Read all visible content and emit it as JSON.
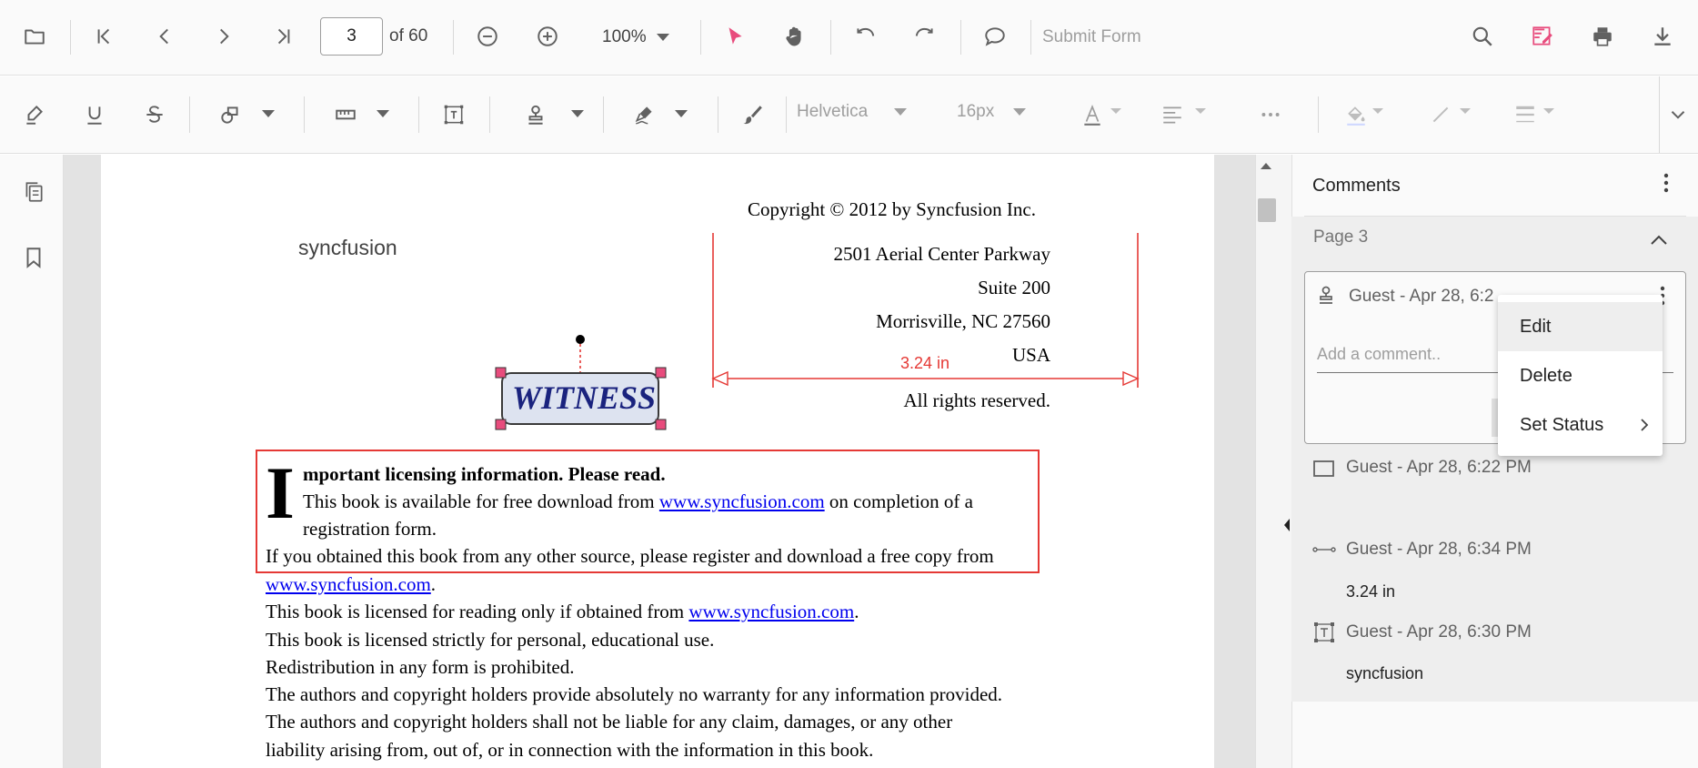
{
  "toolbar": {
    "page_current": "3",
    "page_of": "of 60",
    "zoom": "100%",
    "submit_form": "Submit Form"
  },
  "annotation_toolbar": {
    "font_family": "Helvetica",
    "font_size": "16px"
  },
  "document": {
    "copyright": "Copyright © 2012 by Syncfusion Inc.",
    "free_text": "syncfusion",
    "address_1": "2501 Aerial Center Parkway",
    "address_2": "Suite 200",
    "address_3": "Morrisville, NC 27560",
    "address_4": "USA",
    "measurement": "3.24 in",
    "rights": "All rights reserved.",
    "stamp": "WITNESS",
    "dropcap": "I",
    "heading": "mportant licensing information. Please read.",
    "p1_a": "This book is available for free download from ",
    "p1_link": "www.syncfusion.com",
    "p1_b": " on completion of a",
    "p1_c": "registration form.",
    "p2_a": "If you obtained this book from any other source, please register and download a free copy from",
    "p2_link": "www.syncfusion.com",
    "p2_b": ".",
    "p3_a": "This book is licensed for reading only if obtained from ",
    "p3_link": "www.syncfusion.com",
    "p3_b": ".",
    "p4": "This book is licensed strictly for personal, educational use.",
    "p5": "Redistribution in any form is prohibited.",
    "p6": "The authors and copyright holders provide absolutely no warranty for any information provided.",
    "p7": "The authors and copyright holders shall not be liable for any claim, damages, or any other",
    "p8": "liability arising from, out of, or in connection with the information in this book."
  },
  "comments": {
    "title": "Comments",
    "page_label": "Page 3",
    "card_author": "Guest - Apr 28, 6:2",
    "add_placeholder": "Add a comment..",
    "items": [
      {
        "author": "Guest - Apr 28, 6:22 PM",
        "icon": "rectangle-icon",
        "text": ""
      },
      {
        "author": "Guest - Apr 28, 6:34 PM",
        "icon": "distance-icon",
        "text": "3.24 in"
      },
      {
        "author": "Guest - Apr 28, 6:30 PM",
        "icon": "free-text-icon",
        "text": "syncfusion"
      }
    ]
  },
  "context_menu": {
    "edit": "Edit",
    "delete": "Delete",
    "set_status": "Set Status"
  },
  "colors": {
    "accent": "#e84c7d",
    "annotation_red": "#e53935",
    "stamp_fill": "#dde3f0",
    "stamp_text": "#1a237e"
  }
}
